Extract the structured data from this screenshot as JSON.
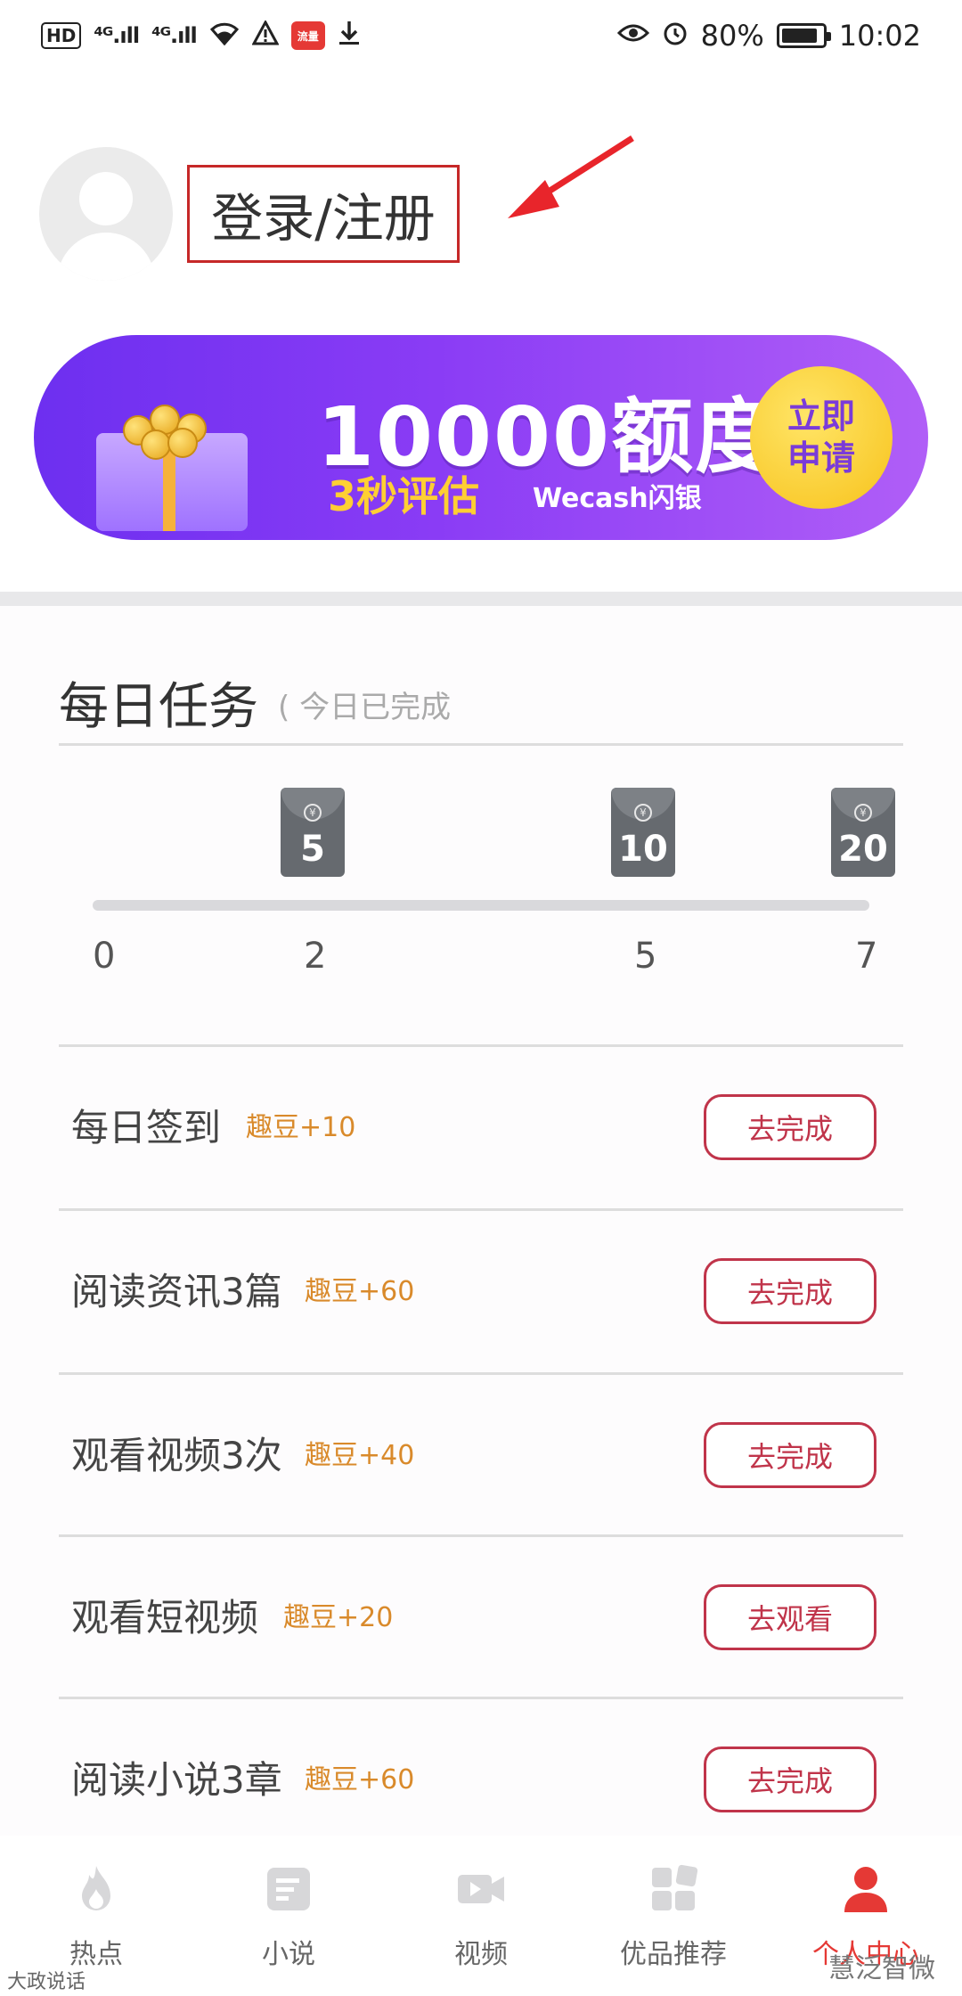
{
  "status_bar": {
    "hd": "HD",
    "net1": "⁴ᴳ.ıll",
    "net2": "⁴ᴳ.ıll",
    "app_badge": "流量",
    "battery": "80%",
    "time": "10:02"
  },
  "profile": {
    "login_label": "登录/注册"
  },
  "banner": {
    "headline": "10000额度",
    "sub": "3秒评估",
    "brand": "Wecash闪银",
    "cta_line1": "立即",
    "cta_line2": "申请"
  },
  "daily_tasks": {
    "title": "每日任务",
    "note": "( 今日已完成",
    "milestones": [
      {
        "reward": "5"
      },
      {
        "reward": "10"
      },
      {
        "reward": "20"
      }
    ],
    "ticks": [
      "0",
      "2",
      "5",
      "7"
    ],
    "items": [
      {
        "name": "每日签到",
        "reward": "趣豆+10",
        "button": "去完成"
      },
      {
        "name": "阅读资讯3篇",
        "reward": "趣豆+60",
        "button": "去完成"
      },
      {
        "name": "观看视频3次",
        "reward": "趣豆+40",
        "button": "去完成"
      },
      {
        "name": "观看短视频",
        "reward": "趣豆+20",
        "button": "去观看"
      },
      {
        "name": "阅读小说3章",
        "reward": "趣豆+60",
        "button": "去完成"
      }
    ]
  },
  "tabbar": {
    "items": [
      {
        "label": "热点",
        "icon": "flame-icon"
      },
      {
        "label": "小说",
        "icon": "book-icon"
      },
      {
        "label": "视频",
        "icon": "video-icon"
      },
      {
        "label": "优品推荐",
        "icon": "grid-icon"
      },
      {
        "label": "个人中心",
        "icon": "person-icon"
      }
    ]
  },
  "watermark": {
    "left": "大政说话",
    "right": "慧泛智微"
  },
  "colors": {
    "accent": "#e53935",
    "button_border": "#c0344a",
    "reward": "#d98a2b",
    "banner": "#7b35f2"
  }
}
